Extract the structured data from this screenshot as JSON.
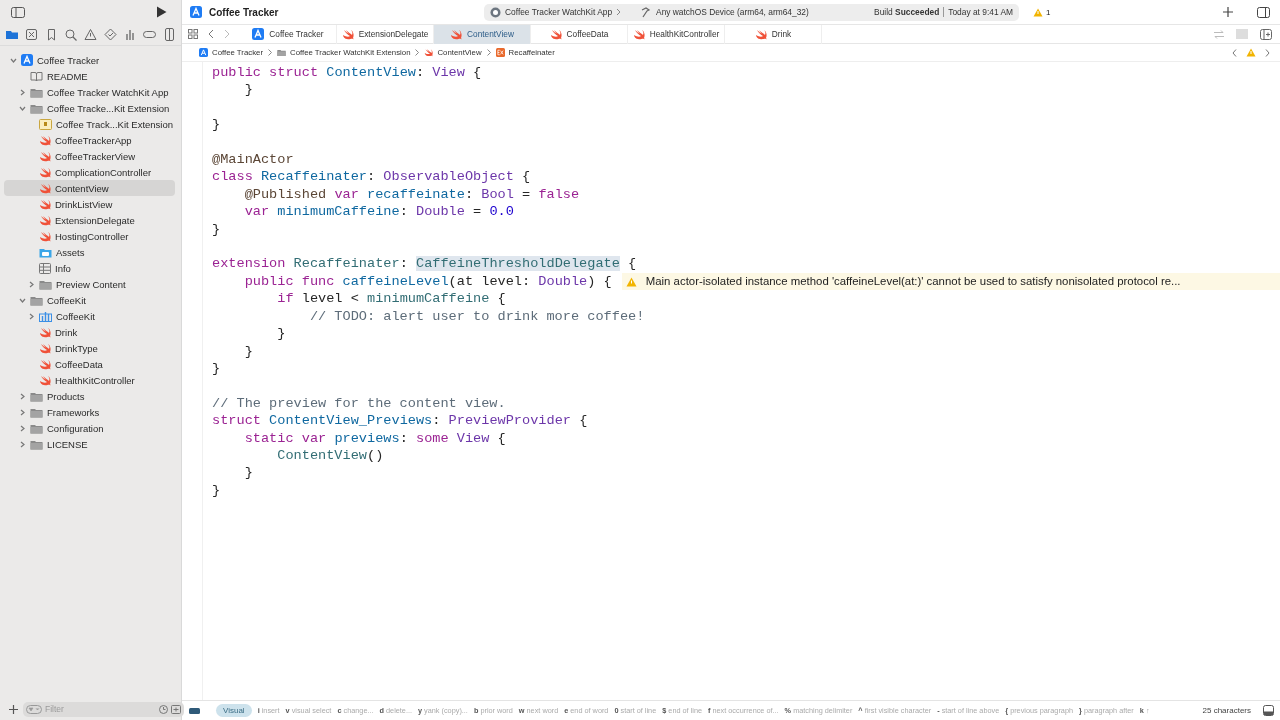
{
  "toolbar": {
    "project": "Coffee Tracker",
    "scheme": "Coffee Tracker WatchKit App",
    "destination": "Any watchOS Device (arm64, arm64_32)",
    "status": "Build **Succeeded**",
    "time": "Today at 9:41 AM",
    "warnings": "1"
  },
  "navigator": {
    "tree": [
      {
        "name": "Coffee Tracker",
        "kind": "project",
        "expanded": true,
        "selected": false,
        "children": [
          {
            "name": "README",
            "kind": "doc",
            "selected": false
          },
          {
            "name": "Coffee Tracker WatchKit App",
            "kind": "folder",
            "expanded": false,
            "selected": false
          },
          {
            "name": "Coffee Tracke...Kit Extension",
            "kind": "folder",
            "expanded": true,
            "selected": false,
            "children": [
              {
                "name": "Coffee Track...Kit Extension",
                "kind": "entitlements",
                "selected": false
              },
              {
                "name": "CoffeeTrackerApp",
                "kind": "swift",
                "selected": false
              },
              {
                "name": "CoffeeTrackerView",
                "kind": "swift",
                "selected": false
              },
              {
                "name": "ComplicationController",
                "kind": "swift",
                "selected": false
              },
              {
                "name": "ContentView",
                "kind": "swift",
                "selected": true
              },
              {
                "name": "DrinkListView",
                "kind": "swift",
                "selected": false
              },
              {
                "name": "ExtensionDelegate",
                "kind": "swift",
                "selected": false
              },
              {
                "name": "HostingController",
                "kind": "swift",
                "selected": false
              },
              {
                "name": "Assets",
                "kind": "assets",
                "selected": false
              },
              {
                "name": "Info",
                "kind": "plist",
                "selected": false
              },
              {
                "name": "Preview Content",
                "kind": "folder",
                "expanded": false,
                "selected": false
              }
            ]
          },
          {
            "name": "CoffeeKit",
            "kind": "folder",
            "expanded": true,
            "selected": false,
            "children": [
              {
                "name": "CoffeeKit",
                "kind": "package",
                "expanded": false,
                "selected": false
              },
              {
                "name": "Drink",
                "kind": "swift",
                "selected": false
              },
              {
                "name": "DrinkType",
                "kind": "swift",
                "selected": false
              },
              {
                "name": "CoffeeData",
                "kind": "swift",
                "selected": false
              },
              {
                "name": "HealthKitController",
                "kind": "swift",
                "selected": false
              }
            ]
          },
          {
            "name": "Products",
            "kind": "folder",
            "expanded": false,
            "selected": false
          },
          {
            "name": "Frameworks",
            "kind": "folder",
            "expanded": false,
            "selected": false
          },
          {
            "name": "Configuration",
            "kind": "folder",
            "expanded": false,
            "selected": false
          },
          {
            "name": "LICENSE",
            "kind": "folder",
            "expanded": false,
            "selected": false
          }
        ]
      }
    ],
    "filter": {
      "placeholder": "Filter"
    }
  },
  "tabs": [
    {
      "label": "Coffee Tracker",
      "kind": "project",
      "selected": false
    },
    {
      "label": "ExtensionDelegate",
      "kind": "swift",
      "selected": false
    },
    {
      "label": "ContentView",
      "kind": "swift",
      "selected": true
    },
    {
      "label": "CoffeeData",
      "kind": "swift",
      "selected": false
    },
    {
      "label": "HealthKitController",
      "kind": "swift",
      "selected": false
    },
    {
      "label": "Drink",
      "kind": "swift",
      "selected": false
    }
  ],
  "jump_bar": [
    {
      "label": "Coffee Tracker",
      "kind": "project"
    },
    {
      "label": "Coffee Tracker WatchKit Extension",
      "kind": "folder"
    },
    {
      "label": "ContentView",
      "kind": "swift"
    },
    {
      "label": "Recaffeinater",
      "kind": "extension"
    }
  ],
  "code": {
    "lines": [
      {
        "tokens": [
          {
            "text": "public struct",
            "kind": "kw"
          },
          {
            "text": " ContentView",
            "kind": "decl"
          },
          {
            "text": ": ",
            "kind": "plain"
          },
          {
            "text": "View",
            "kind": "type"
          },
          {
            "text": " {",
            "kind": "plain"
          }
        ]
      },
      {
        "tokens": [
          {
            "text": "    }",
            "kind": "plain"
          }
        ]
      },
      {
        "kind": "blank"
      },
      {
        "tokens": [
          {
            "text": "}",
            "kind": "plain"
          }
        ]
      },
      {
        "kind": "blank"
      },
      {
        "tokens": [
          {
            "text": "@MainActor",
            "kind": "attr"
          }
        ]
      },
      {
        "tokens": [
          {
            "text": "class",
            "kind": "kw"
          },
          {
            "text": " Recaffeinater",
            "kind": "decl"
          },
          {
            "text": ": ",
            "kind": "plain"
          },
          {
            "text": "ObservableObject",
            "kind": "type"
          },
          {
            "text": " {",
            "kind": "plain"
          }
        ]
      },
      {
        "tokens": [
          {
            "text": "    @Published",
            "kind": "attr"
          },
          {
            "text": " var",
            "kind": "kw"
          },
          {
            "text": " recaffeinate",
            "kind": "decl"
          },
          {
            "text": ": ",
            "kind": "plain"
          },
          {
            "text": "Bool",
            "kind": "type"
          },
          {
            "text": " = ",
            "kind": "plain"
          },
          {
            "text": "false",
            "kind": "kw"
          }
        ]
      },
      {
        "tokens": [
          {
            "text": "    var",
            "kind": "kw"
          },
          {
            "text": " minimumCaffeine",
            "kind": "decl"
          },
          {
            "text": ": ",
            "kind": "plain"
          },
          {
            "text": "Double",
            "kind": "type"
          },
          {
            "text": " = ",
            "kind": "plain"
          },
          {
            "text": "0.0",
            "kind": "num"
          }
        ]
      },
      {
        "tokens": [
          {
            "text": "}",
            "kind": "plain"
          }
        ]
      },
      {
        "kind": "blank"
      },
      {
        "tokens": [
          {
            "text": "extension",
            "kind": "kw"
          },
          {
            "text": " Recaffeinater",
            "kind": "ref"
          },
          {
            "text": ": ",
            "kind": "plain"
          },
          {
            "text": "CaffeineThresholdDelegate",
            "kind": "selection"
          },
          {
            "text": " {",
            "kind": "plain"
          }
        ]
      },
      {
        "tokens": [
          {
            "text": "    public func",
            "kind": "kw"
          },
          {
            "text": " caffeineLevel",
            "kind": "decl"
          },
          {
            "text": "(at level: ",
            "kind": "plain"
          },
          {
            "text": "Double",
            "kind": "type"
          },
          {
            "text": ") {",
            "kind": "plain"
          }
        ],
        "warning": "Main actor-isolated instance method 'caffeineLevel(at:)' cannot be used to satisfy nonisolated protocol re..."
      },
      {
        "tokens": [
          {
            "text": "        if",
            "kind": "kw"
          },
          {
            "text": " level < ",
            "kind": "plain"
          },
          {
            "text": "minimumCaffeine",
            "kind": "ref"
          },
          {
            "text": " {",
            "kind": "plain"
          }
        ]
      },
      {
        "tokens": [
          {
            "text": "            // TODO: alert user to drink more coffee!",
            "kind": "comment"
          }
        ]
      },
      {
        "tokens": [
          {
            "text": "        }",
            "kind": "plain"
          }
        ]
      },
      {
        "tokens": [
          {
            "text": "    }",
            "kind": "plain"
          }
        ]
      },
      {
        "tokens": [
          {
            "text": "}",
            "kind": "plain"
          }
        ]
      },
      {
        "kind": "blank"
      },
      {
        "tokens": [
          {
            "text": "// The preview for the content view.",
            "kind": "comment"
          }
        ]
      },
      {
        "tokens": [
          {
            "text": "struct",
            "kind": "kw"
          },
          {
            "text": " ContentView_Previews",
            "kind": "decl"
          },
          {
            "text": ": ",
            "kind": "plain"
          },
          {
            "text": "PreviewProvider",
            "kind": "type"
          },
          {
            "text": " {",
            "kind": "plain"
          }
        ]
      },
      {
        "tokens": [
          {
            "text": "    static var",
            "kind": "kw"
          },
          {
            "text": " previews",
            "kind": "decl"
          },
          {
            "text": ": ",
            "kind": "plain"
          },
          {
            "text": "some",
            "kind": "kw"
          },
          {
            "text": " View",
            "kind": "type"
          },
          {
            "text": " {",
            "kind": "plain"
          }
        ]
      },
      {
        "tokens": [
          {
            "text": "        ContentView",
            "kind": "ref"
          },
          {
            "text": "()",
            "kind": "plain"
          }
        ]
      },
      {
        "tokens": [
          {
            "text": "    }",
            "kind": "plain"
          }
        ]
      },
      {
        "tokens": [
          {
            "text": "}",
            "kind": "plain"
          }
        ]
      }
    ]
  },
  "status_bar": {
    "mode": "Visual",
    "hints": [
      {
        "key": "i",
        "text": "insert"
      },
      {
        "key": "v",
        "text": "visual select"
      },
      {
        "key": "c",
        "text": "change..."
      },
      {
        "key": "d",
        "text": "delete..."
      },
      {
        "key": "y",
        "text": "yank (copy)..."
      },
      {
        "key": "b",
        "text": "prior word"
      },
      {
        "key": "w",
        "text": "next word"
      },
      {
        "key": "e",
        "text": "end of word"
      },
      {
        "key": "0",
        "text": "start of line"
      },
      {
        "key": "$",
        "text": "end of line"
      },
      {
        "key": "f",
        "text": "next occurrence of..."
      },
      {
        "key": "%",
        "text": "matching delimiter"
      },
      {
        "key": "^",
        "text": "first visible character"
      },
      {
        "key": "-",
        "text": "start of line above"
      },
      {
        "key": "{",
        "text": "previous paragraph"
      },
      {
        "key": "}",
        "text": "paragraph after"
      },
      {
        "key": "k",
        "text": "↑"
      }
    ],
    "count": "25 characters"
  }
}
